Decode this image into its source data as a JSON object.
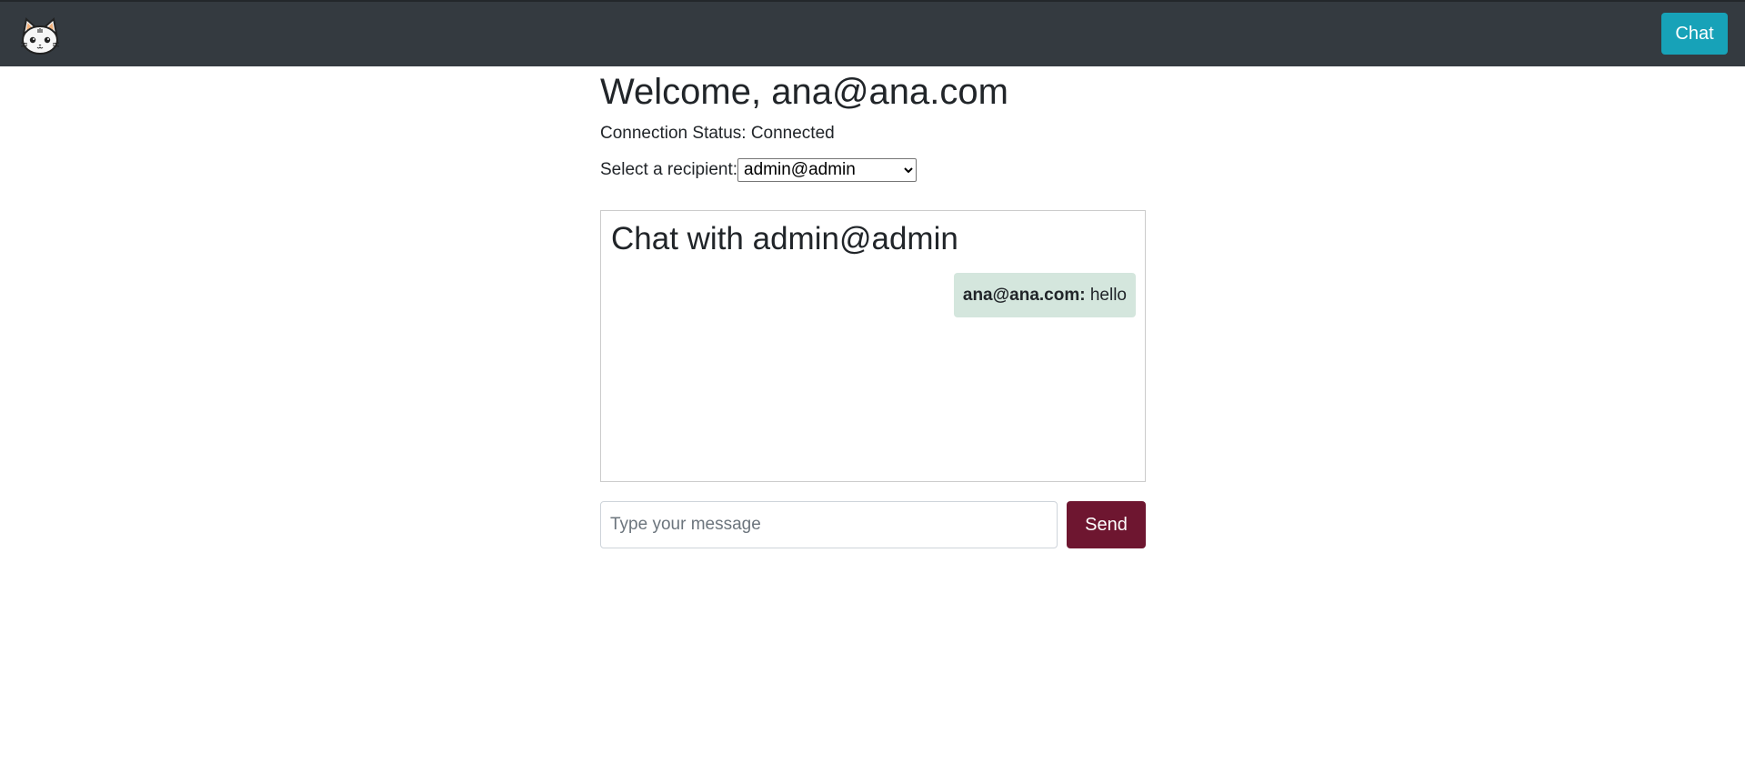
{
  "navbar": {
    "logo_icon": "cat-face-icon",
    "chat_button_label": "Chat",
    "colors": {
      "background": "#343a40",
      "chat_button": "#17a2b8"
    }
  },
  "main": {
    "welcome_text": "Welcome, ana@ana.com",
    "connection_status": "Connection Status: Connected",
    "recipient_label": "Select a recipient:",
    "recipient_selected": "admin@admin"
  },
  "chat": {
    "title": "Chat with admin@admin",
    "messages": [
      {
        "sender": "ana@ana.com:",
        "text": "hello",
        "background": "#d4e6dd"
      }
    ]
  },
  "composer": {
    "placeholder": "Type your message",
    "value": "",
    "send_label": "Send",
    "send_color": "#6e1630"
  }
}
